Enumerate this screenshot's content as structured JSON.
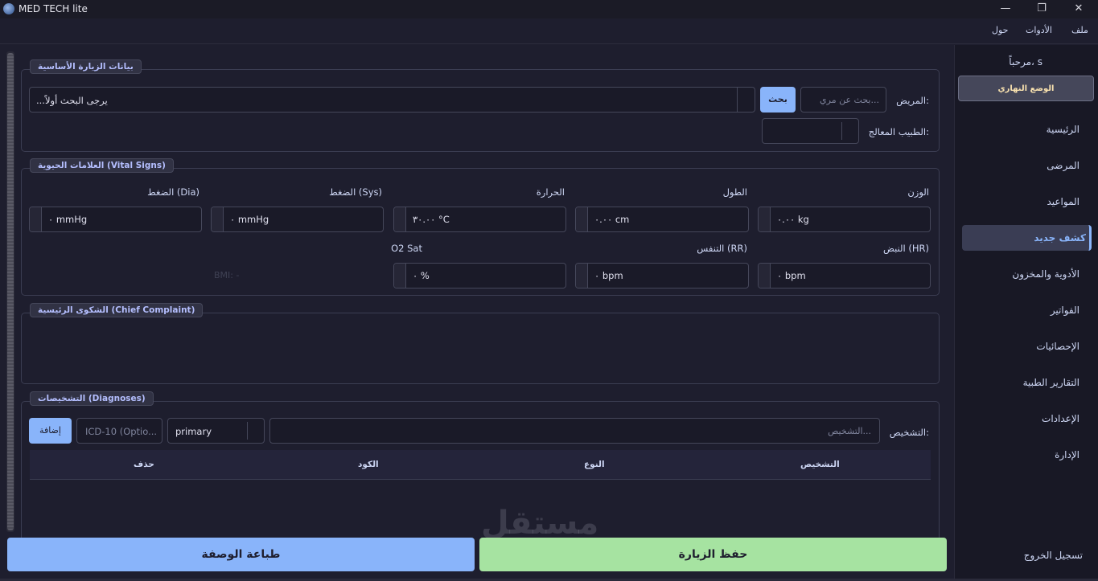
{
  "window": {
    "title": "MED TECH lite",
    "minimize": "—",
    "maximize": "❐",
    "close": "✕"
  },
  "menu": {
    "file": "ملف",
    "tools": "الأدوات",
    "about": "حول"
  },
  "sidebar": {
    "welcome": "مرحباً، s",
    "theme_button": "الوضع النهاري",
    "items": [
      "الرئيسية",
      "المرضى",
      "المواعيد",
      "كشف جديد",
      "الأدوية والمخزون",
      "الفواتير",
      "الإحصائيات",
      "التقارير الطبية",
      "الإعدادات",
      "الإدارة"
    ],
    "logout": "تسجيل الخروج"
  },
  "visit": {
    "title": "بيانات الزيارة الأساسية",
    "patient_label": "المريض:",
    "patient_search_placeholder": "بحث عن مري...",
    "search_button": "بحث",
    "patient_combo_value": "...يرجى البحث أولاً",
    "doctor_label": "الطبيب المعالج:"
  },
  "vitals": {
    "title": "العلامات الحيوية (Vital Signs)",
    "weight_label": "الوزن",
    "weight_value": "٠.٠٠ kg",
    "height_label": "الطول",
    "height_value": "٠.٠٠ cm",
    "temp_label": "الحرارة",
    "temp_value": "٣٠.٠٠ °C",
    "sys_label": "الضغط (Sys)",
    "sys_value": "٠ mmHg",
    "dia_label": "الضغط (Dia)",
    "dia_value": "٠ mmHg",
    "hr_label": "النبض (HR)",
    "hr_value": "٠ bpm",
    "rr_label": "التنفس (RR)",
    "rr_value": "٠ bpm",
    "o2_label": "O2 Sat",
    "o2_value": "٠ %",
    "bmi": "BMI: -"
  },
  "complaint": {
    "title": "الشكوى الرئيسية (Chief Complaint)"
  },
  "diagnoses": {
    "title": "التشخيصات (Diagnoses)",
    "label": "التشخيص:",
    "diag_placeholder": "التشخيص...",
    "type_value": "primary",
    "icd_placeholder": "ICD-10 (Optio...",
    "add_button": "إضافة",
    "columns": [
      "التشخيص",
      "النوع",
      "الكود",
      "حذف"
    ]
  },
  "actions": {
    "save": "حفظ الزيارة",
    "print": "طباعة الوصفة"
  },
  "watermark": "مستقل"
}
